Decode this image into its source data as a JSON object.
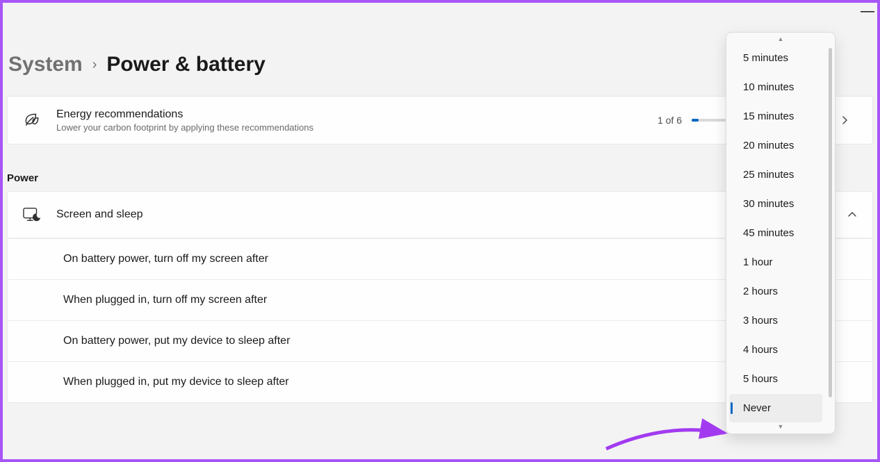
{
  "breadcrumb": {
    "parent": "System",
    "separator": "›",
    "current": "Power & battery"
  },
  "energy": {
    "title": "Energy recommendations",
    "subtitle": "Lower your carbon footprint by applying these recommendations",
    "count": "1 of 6"
  },
  "section": {
    "label": "Power"
  },
  "screenSleep": {
    "title": "Screen and sleep",
    "rows": [
      "On battery power, turn off my screen after",
      "When plugged in, turn off my screen after",
      "On battery power, put my device to sleep after",
      "When plugged in, put my device to sleep after"
    ]
  },
  "dropdown": {
    "options": [
      "5 minutes",
      "10 minutes",
      "15 minutes",
      "20 minutes",
      "25 minutes",
      "30 minutes",
      "45 minutes",
      "1 hour",
      "2 hours",
      "3 hours",
      "4 hours",
      "5 hours",
      "Never"
    ],
    "selectedIndex": 12
  }
}
